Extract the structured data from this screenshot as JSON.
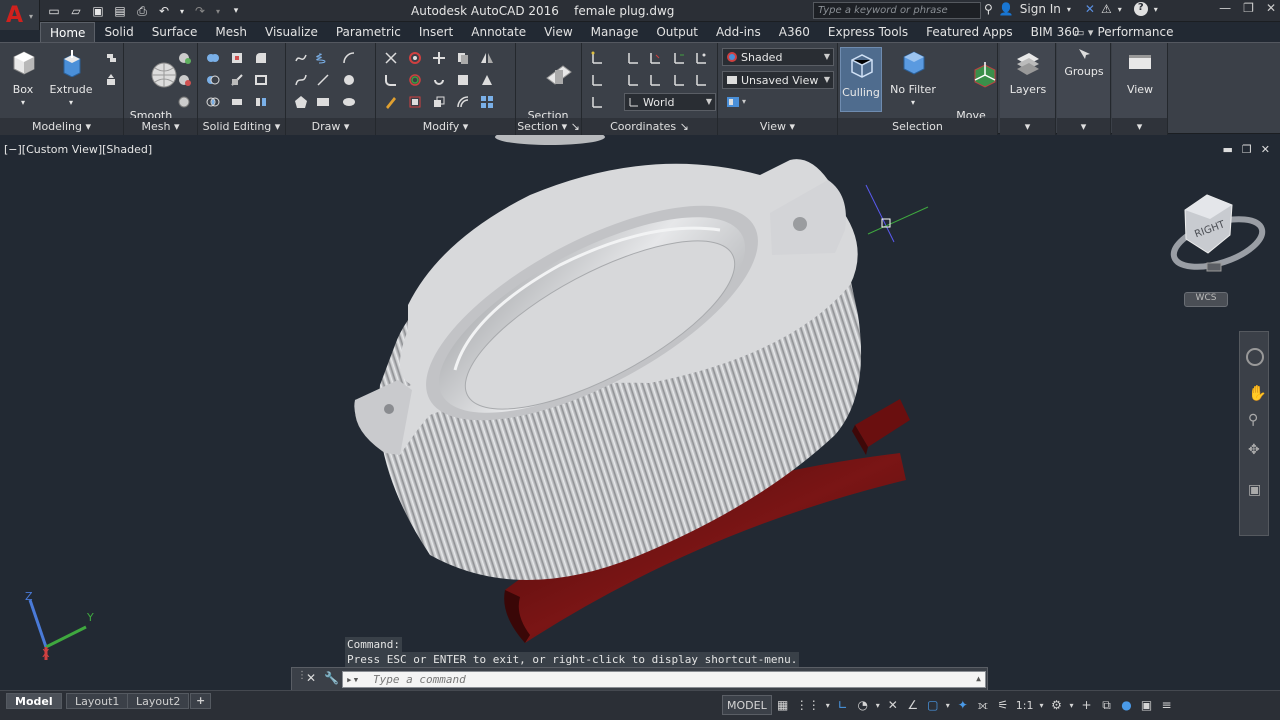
{
  "app": {
    "title": "Autodesk AutoCAD 2016    female plug.dwg",
    "logo": "A"
  },
  "search": {
    "placeholder": "Type a keyword or phrase"
  },
  "account": {
    "sign_in": "Sign In"
  },
  "tabs": [
    "Home",
    "Solid",
    "Surface",
    "Mesh",
    "Visualize",
    "Parametric",
    "Insert",
    "Annotate",
    "View",
    "Manage",
    "Output",
    "Add-ins",
    "A360",
    "Express Tools",
    "Featured Apps",
    "BIM 360",
    "Performance"
  ],
  "ribbon": {
    "modeling": {
      "title": "Modeling",
      "box": "Box",
      "extrude": "Extrude"
    },
    "mesh": {
      "title": "Mesh",
      "smooth_object": "Smooth\nObject"
    },
    "solid_editing": {
      "title": "Solid Editing"
    },
    "draw": {
      "title": "Draw"
    },
    "modify": {
      "title": "Modify"
    },
    "section": {
      "title": "Section",
      "section_plane": "Section\nPlane"
    },
    "coordinates": {
      "title": "Coordinates",
      "ucs": "World"
    },
    "view": {
      "title": "View",
      "visual_style": "Shaded",
      "named_view": "Unsaved View"
    },
    "selection": {
      "title": "Selection",
      "culling": "Culling",
      "no_filter": "No Filter",
      "move_gizmo": "Move\nGizmo"
    },
    "layers": "Layers",
    "groups": "Groups",
    "view_btn": "View"
  },
  "viewport": {
    "label": "[−][Custom View][Shaded]",
    "viewcube_face": "RIGHT",
    "wcs": "WCS",
    "axes": {
      "x": "X",
      "y": "Y",
      "z": "Z"
    }
  },
  "command": {
    "history": [
      "Command:",
      "Press ESC or ENTER to exit, or right-click to display shortcut-menu."
    ],
    "placeholder": "Type a command"
  },
  "status": {
    "layouts": [
      "Model",
      "Layout1",
      "Layout2"
    ],
    "model": "MODEL",
    "scale": "1:1"
  },
  "colors": {
    "background": "#222933",
    "part": "#d9dadc",
    "gasket": "#6a0f0f",
    "ribbon": "#3b4048",
    "accent_red": "#d0211d"
  }
}
